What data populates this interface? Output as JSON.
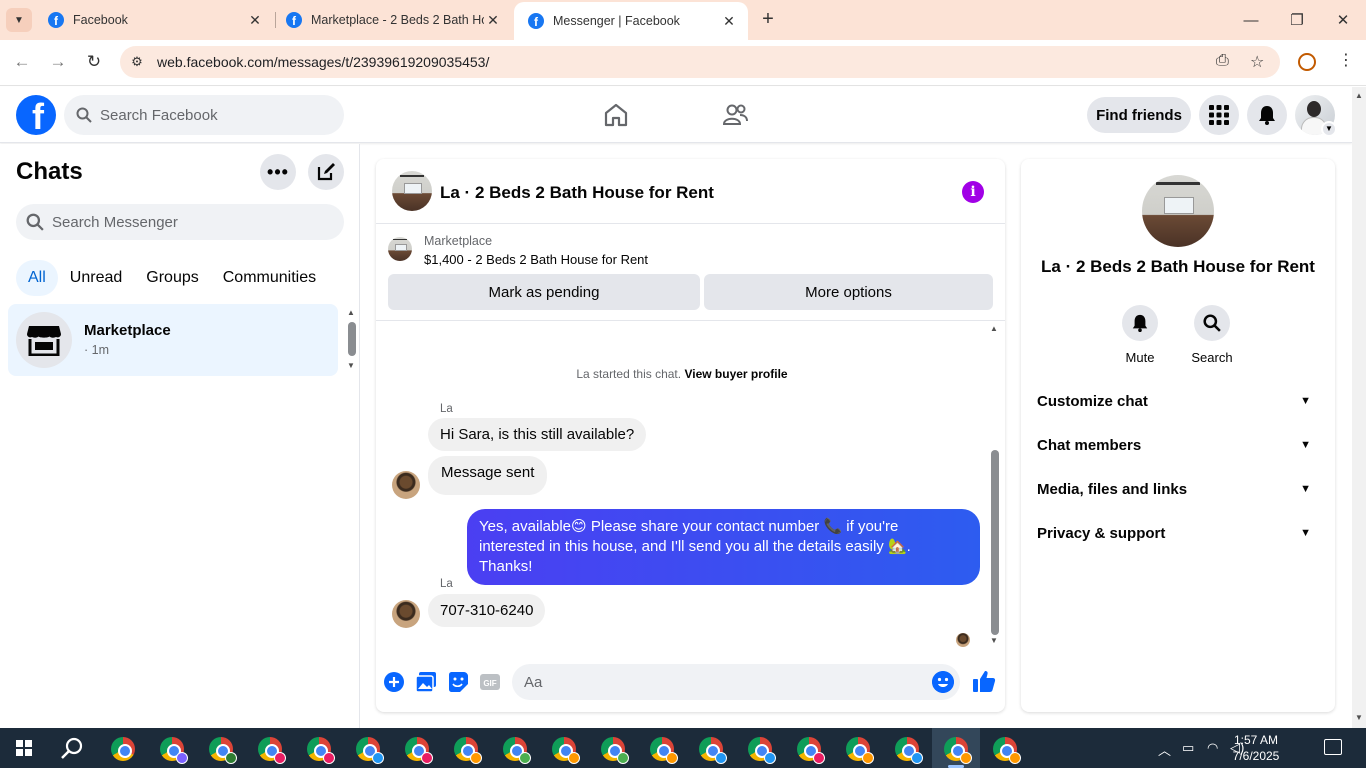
{
  "browser": {
    "tabs": [
      {
        "title": "Facebook"
      },
      {
        "title": "Marketplace - 2 Beds 2 Bath Ho"
      },
      {
        "title": "Messenger | Facebook"
      }
    ],
    "url": "web.facebook.com/messages/t/23939619209035453/"
  },
  "fb_nav": {
    "search_placeholder": "Search Facebook",
    "find_friends": "Find friends"
  },
  "chats": {
    "title": "Chats",
    "search_placeholder": "Search Messenger",
    "filters": [
      "All",
      "Unread",
      "Groups",
      "Communities"
    ],
    "items": [
      {
        "name": "Marketplace",
        "sub": "· 1m"
      }
    ]
  },
  "conversation": {
    "title": "La · 2 Beds 2 Bath House for Rent",
    "marketplace_label": "Marketplace",
    "listing": "$1,400 - 2 Beds 2 Bath House for Rent",
    "mark_pending": "Mark as pending",
    "more_options": "More options",
    "start_text": "La started this chat.",
    "buyer_profile": "View buyer profile",
    "messages": [
      {
        "sender": "La",
        "text": "Hi Sara, is this still available?"
      },
      {
        "text": "Message sent"
      },
      {
        "text": "Yes, available😊 Please share your contact number 📞 if you're interested in this house, and I'll send you all the details easily 🏡. Thanks!"
      },
      {
        "sender": "La",
        "text": "707-310-6240"
      }
    ],
    "composer_placeholder": "Aa"
  },
  "info_panel": {
    "title": "La · 2 Beds 2 Bath House for Rent",
    "actions": [
      "Mute",
      "Search"
    ],
    "sections": [
      "Customize chat",
      "Chat members",
      "Media, files and links",
      "Privacy & support"
    ]
  },
  "taskbar": {
    "time": "1:57 AM",
    "date": "7/6/2025"
  },
  "colors": {
    "fb_blue": "#0866ff",
    "outgoing_bubble": "#3f3ff0",
    "info_purple": "#a100e6"
  }
}
